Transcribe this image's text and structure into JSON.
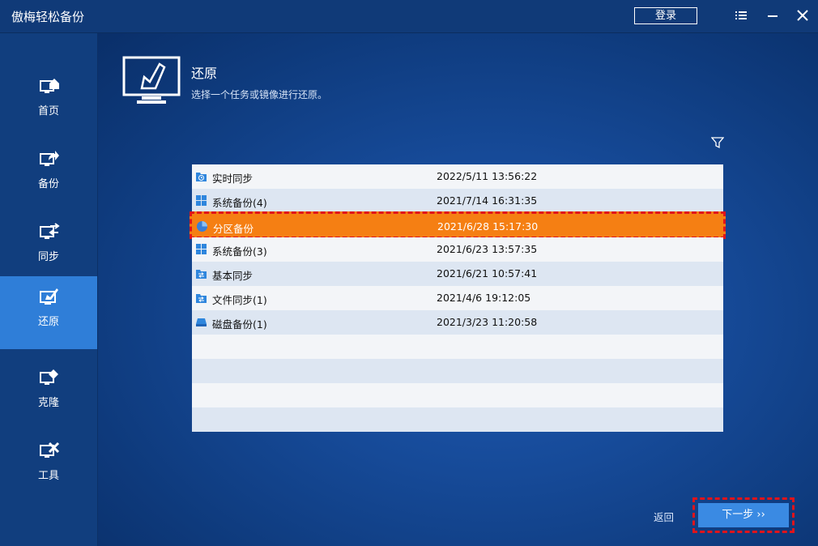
{
  "app": {
    "title": "傲梅轻松备份",
    "login_label": "登录"
  },
  "sidebar": {
    "items": [
      {
        "label": "首页",
        "icon": "home-icon"
      },
      {
        "label": "备份",
        "icon": "backup-icon"
      },
      {
        "label": "同步",
        "icon": "sync-icon"
      },
      {
        "label": "还原",
        "icon": "restore-icon",
        "active": true
      },
      {
        "label": "克隆",
        "icon": "clone-icon"
      },
      {
        "label": "工具",
        "icon": "tools-icon"
      }
    ]
  },
  "header": {
    "title": "还原",
    "subtitle": "选择一个任务或镜像进行还原。"
  },
  "tasks": [
    {
      "name": "实时同步",
      "time": "2022/5/11 13:56:22",
      "icon": "realtime-sync-icon"
    },
    {
      "name": "系统备份(4)",
      "time": "2021/7/14 16:31:35",
      "icon": "windows-icon"
    },
    {
      "name": "分区备份",
      "time": "2021/6/28 15:17:30",
      "icon": "partition-icon",
      "selected": true
    },
    {
      "name": "系统备份(3)",
      "time": "2021/6/23 13:57:35",
      "icon": "windows-icon"
    },
    {
      "name": "基本同步",
      "time": "2021/6/21 10:57:41",
      "icon": "folder-sync-icon"
    },
    {
      "name": "文件同步(1)",
      "time": "2021/4/6 19:12:05",
      "icon": "folder-sync-icon"
    },
    {
      "name": "磁盘备份(1)",
      "time": "2021/3/23 11:20:58",
      "icon": "disk-icon"
    }
  ],
  "footer": {
    "back_label": "返回",
    "next_label": "下一步 ››"
  },
  "colors": {
    "accent": "#2f7ed8",
    "selected_row": "#f57f13",
    "highlight_border": "#e0141b"
  }
}
